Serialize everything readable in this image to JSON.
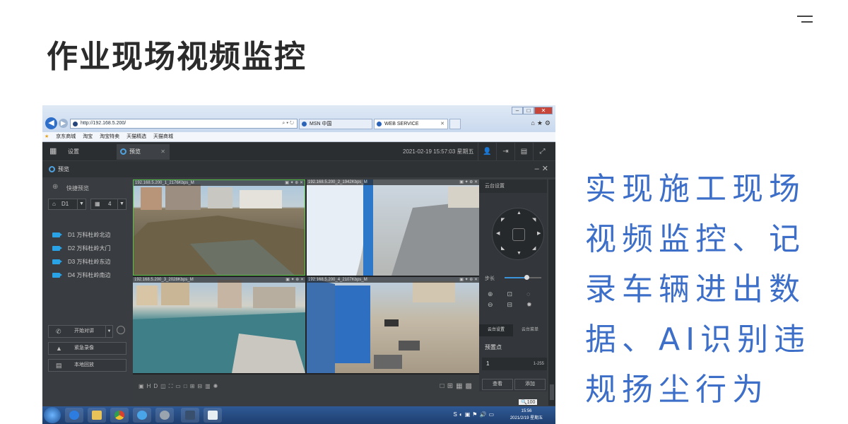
{
  "slide": {
    "title": "作业现场视频监控",
    "description": "实现施工现场视频监控、记录车辆进出数据、AI识别违规扬尘行为"
  },
  "browser": {
    "url": "http://192.168.5.200/",
    "tabs": [
      {
        "label": "MSN 中国"
      },
      {
        "label": "WEB SERVICE"
      }
    ],
    "favorites": [
      "京东商城",
      "淘宝",
      "淘宝特卖",
      "天猫精选",
      "天猫商城"
    ]
  },
  "app": {
    "setup_tab": "设置",
    "preview_tab": "预览",
    "datetime": "2021-02-19 15:57:03 星期五",
    "panel_title": "预览",
    "quick_preview": "快捷预览",
    "device_select": "D1",
    "layout_select": "4",
    "cameras": [
      {
        "label": "D1 万科杜岭北边"
      },
      {
        "label": "D2 万科杜岭大门"
      },
      {
        "label": "D3 万科杜岭东边"
      },
      {
        "label": "D4 万科杜岭南边"
      }
    ],
    "buttons": {
      "talk": "开始对讲",
      "emergency": "紧急录像",
      "playback": "本地回放"
    },
    "video_labels": [
      "192.168.5.200_1_2176Kbps_M",
      "192.168.5.200_2_1942Kbps_M",
      "192.168.5.200_3_2028Kbps_M",
      "192.168.5.200_4_2107Kbps_M"
    ],
    "ptz": {
      "header": "云台设置",
      "step_label": "步长",
      "step_value": 0.6,
      "tab_ptz": "云台设置",
      "tab_menu": "云台菜单",
      "preset_header": "预置点",
      "preset_value": "1",
      "preset_range": "1-255",
      "btn_view": "查看",
      "btn_add": "添加"
    },
    "toolbar_hd": "HD",
    "zoom_indicator": "100"
  },
  "taskbar": {
    "time": "15:56",
    "date": "2021/2/19 星期五"
  },
  "colors": {
    "accent_blue": "#3d6fc8",
    "title": "#2b2b2b",
    "selected_tile": "#58c248"
  }
}
